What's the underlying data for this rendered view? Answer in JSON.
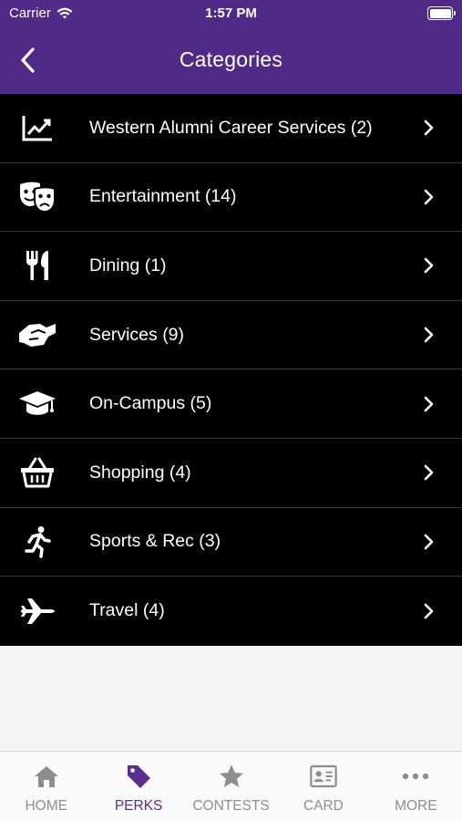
{
  "status_bar": {
    "carrier": "Carrier",
    "time": "1:57 PM"
  },
  "nav": {
    "title": "Categories",
    "back_icon": "chevron-left-icon"
  },
  "categories": [
    {
      "label": "Western Alumni Career Services (2)",
      "icon": "chart-line-icon"
    },
    {
      "label": "Entertainment (14)",
      "icon": "theater-masks-icon"
    },
    {
      "label": "Dining (1)",
      "icon": "utensils-icon"
    },
    {
      "label": "Services (9)",
      "icon": "handshake-icon"
    },
    {
      "label": "On-Campus (5)",
      "icon": "graduation-cap-icon"
    },
    {
      "label": "Shopping (4)",
      "icon": "shopping-basket-icon"
    },
    {
      "label": "Sports & Rec (3)",
      "icon": "running-person-icon"
    },
    {
      "label": "Travel (4)",
      "icon": "airplane-icon"
    }
  ],
  "tabs": [
    {
      "label": "HOME",
      "icon": "home-icon",
      "active": false
    },
    {
      "label": "PERKS",
      "icon": "tag-icon",
      "active": true
    },
    {
      "label": "CONTESTS",
      "icon": "star-icon",
      "active": false
    },
    {
      "label": "CARD",
      "icon": "id-card-icon",
      "active": false
    },
    {
      "label": "MORE",
      "icon": "more-dots-icon",
      "active": false
    }
  ],
  "colors": {
    "header": "#4f2a86",
    "list_background": "#000000",
    "tab_active": "#5c2d91",
    "tab_inactive": "#8e8e8e"
  }
}
